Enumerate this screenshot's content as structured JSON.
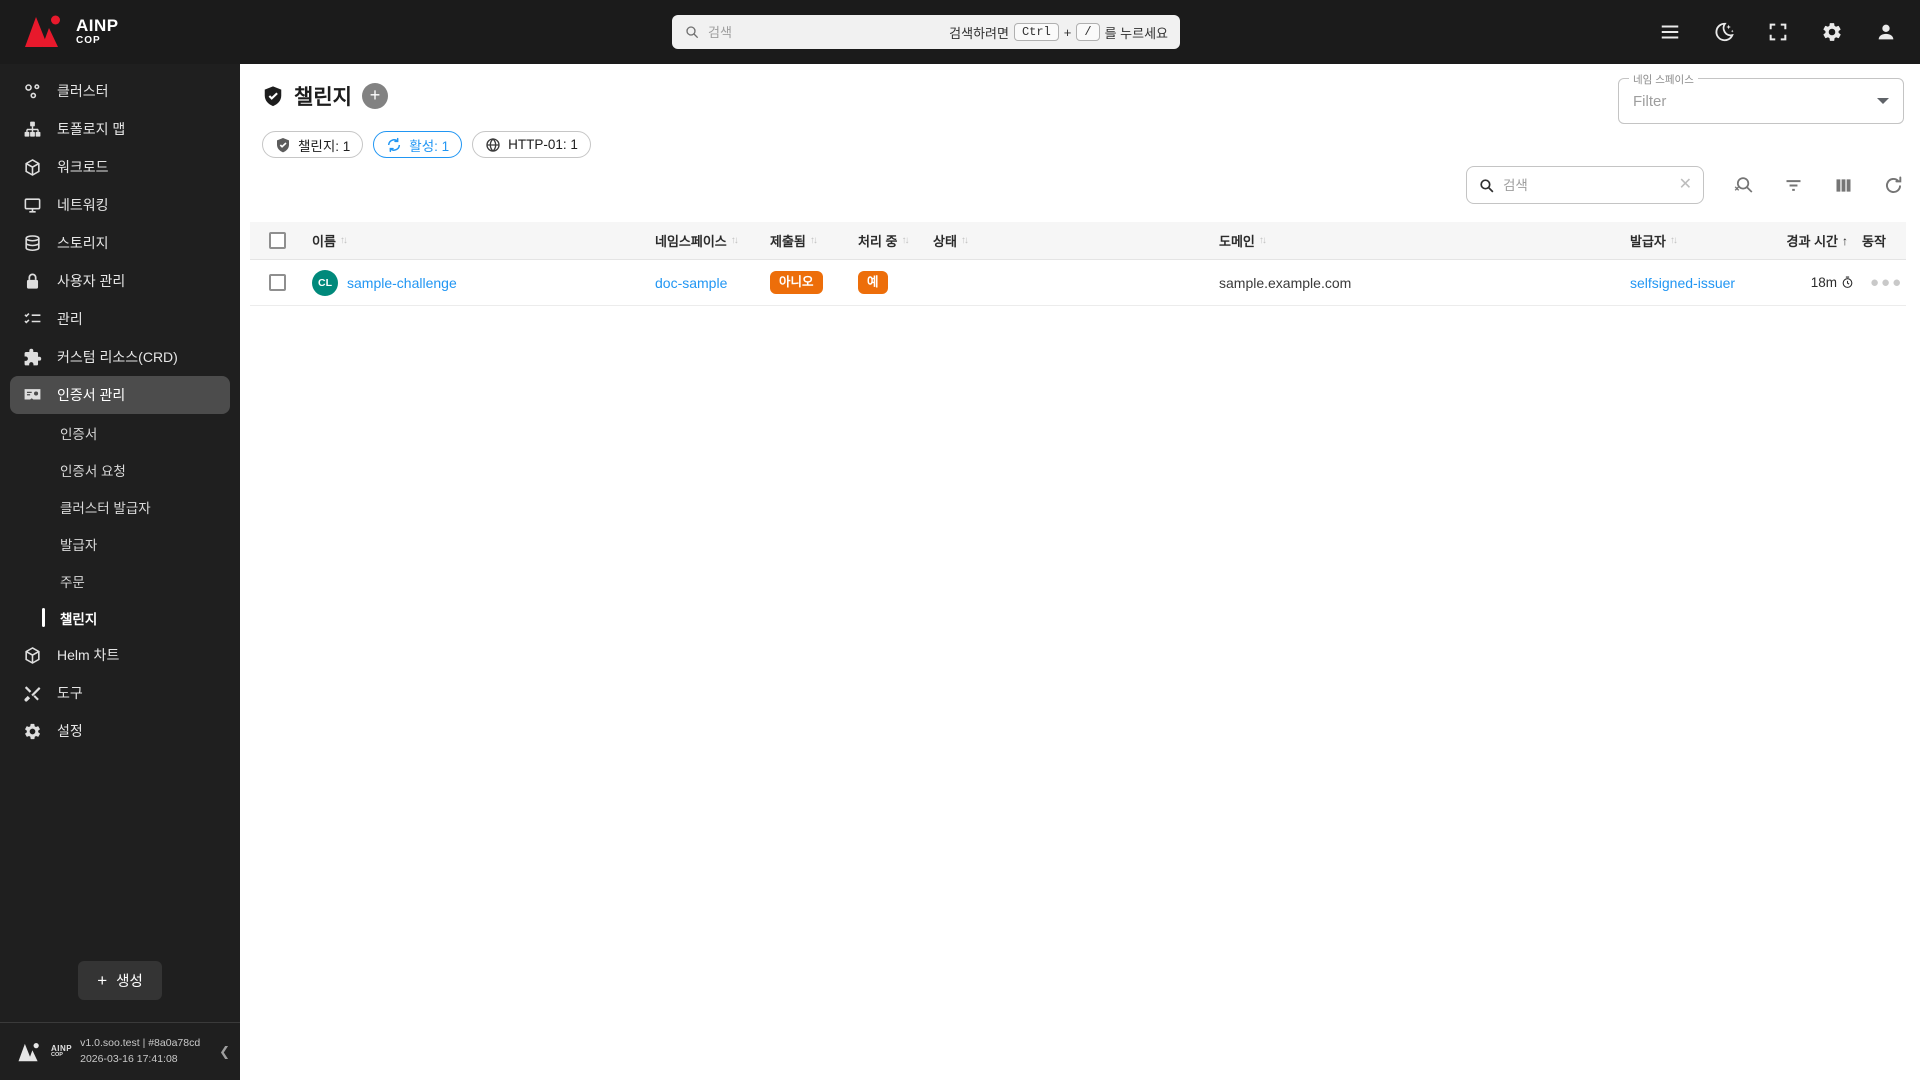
{
  "topbar": {
    "brand_primary": "AINP",
    "brand_secondary": "COP",
    "search_placeholder": "검색",
    "hint_prefix": "검색하려면",
    "kbd_ctrl": "Ctrl",
    "hint_plus": "+",
    "kbd_slash": "/",
    "hint_suffix": "를 누르세요"
  },
  "sidebar": {
    "items": [
      {
        "label": "클러스터",
        "icon": "cluster-icon"
      },
      {
        "label": "토폴로지 맵",
        "icon": "topology-icon"
      },
      {
        "label": "워크로드",
        "icon": "workload-icon"
      },
      {
        "label": "네트워킹",
        "icon": "networking-icon"
      },
      {
        "label": "스토리지",
        "icon": "storage-icon"
      },
      {
        "label": "사용자 관리",
        "icon": "user-management-icon"
      },
      {
        "label": "관리",
        "icon": "admin-icon"
      },
      {
        "label": "커스텀 리소스(CRD)",
        "icon": "crd-icon"
      },
      {
        "label": "인증서 관리",
        "icon": "certificate-icon",
        "selected": true
      }
    ],
    "cert_submenu": [
      {
        "label": "인증서"
      },
      {
        "label": "인증서 요청"
      },
      {
        "label": "클러스터 발급자"
      },
      {
        "label": "발급자"
      },
      {
        "label": "주문"
      },
      {
        "label": "챌린지",
        "selected": true
      }
    ],
    "bottom_items": [
      {
        "label": "Helm 차트",
        "icon": "helm-chart-icon"
      },
      {
        "label": "도구",
        "icon": "tools-icon"
      },
      {
        "label": "설정",
        "icon": "settings-icon"
      }
    ],
    "create_label": "생성",
    "footer": {
      "brand_primary": "AINP",
      "brand_secondary": "COP",
      "version": "v1.0.soo.test | #8a0a78cd",
      "datetime": "2026-03-16 17:41:08"
    }
  },
  "main": {
    "title": "챌린지",
    "namespace_filter": {
      "label": "네임 스페이스",
      "placeholder": "Filter"
    },
    "chips": [
      {
        "label": "챌린지: 1",
        "icon": "shield-check-icon",
        "active": false
      },
      {
        "label": "활성: 1",
        "icon": "sync-icon",
        "active": true
      },
      {
        "label": "HTTP-01: 1",
        "icon": "globe-icon",
        "active": false
      }
    ],
    "table_search_placeholder": "검색",
    "table": {
      "columns": [
        {
          "label": "이름",
          "sort": "idle"
        },
        {
          "label": "네임스페이스",
          "sort": "idle"
        },
        {
          "label": "제출됨",
          "sort": "idle"
        },
        {
          "label": "처리 중",
          "sort": "idle"
        },
        {
          "label": "상태",
          "sort": "idle"
        },
        {
          "label": "도메인",
          "sort": "idle"
        },
        {
          "label": "발급자",
          "sort": "idle"
        },
        {
          "label": "경과 시간",
          "sort": "asc"
        },
        {
          "label": "동작",
          "sort": "none"
        }
      ],
      "rows": [
        {
          "avatar": "CL",
          "name": "sample-challenge",
          "namespace": "doc-sample",
          "submitted": "아니오",
          "processing": "예",
          "status": "",
          "domain": "sample.example.com",
          "issuer": "selfsigned-issuer",
          "elapsed": "18m"
        }
      ]
    }
  },
  "colors": {
    "topbar_bg": "#1b1b1b",
    "sidebar_bg": "#1f1f1f",
    "selected_item_bg": "#4c4c4c",
    "brand_red": "#e8192c",
    "link_blue": "#2196f3",
    "chip_active_blue": "#2196f3",
    "badge_orange": "#ed6e0a",
    "avatar_teal": "#00897b"
  }
}
